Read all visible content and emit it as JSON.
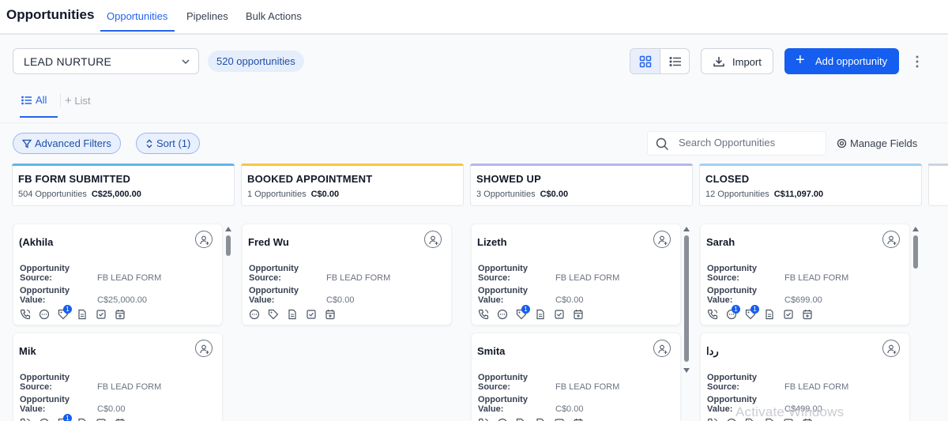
{
  "header": {
    "title": "Opportunities",
    "tabs": [
      {
        "label": "Opportunities",
        "active": true
      },
      {
        "label": "Pipelines",
        "active": false
      },
      {
        "label": "Bulk Actions",
        "active": false
      }
    ]
  },
  "toolbar": {
    "pipeline": "LEAD NURTURE",
    "count": "520 opportunities",
    "view_mode": "board",
    "import_label": "Import",
    "add_label": "Add opportunity"
  },
  "subtabs": {
    "all_label": "All",
    "list_label": "List"
  },
  "filters": {
    "advanced_label": "Advanced Filters",
    "sort_label": "Sort (1)",
    "search_placeholder": "Search Opportunities",
    "manage_fields_label": "Manage Fields"
  },
  "labels": {
    "source_key": "Opportunity Source:",
    "value_key": "Opportunity Value:"
  },
  "colors": {
    "accent": "#155eef",
    "fb_form_submitted": "#5fb6e8",
    "booked_appointment": "#f5c842",
    "showed_up": "#b7b4ef",
    "closed": "#9fd2ef"
  },
  "stages": [
    {
      "name": "FB FORM SUBMITTED",
      "count": "504 Opportunities",
      "value": "C$25,000.00",
      "cards": [
        {
          "name": "(Akhila",
          "source": "FB LEAD FORM",
          "value": "C$25,000.00",
          "icons": [
            "phone-icon",
            "chat-icon",
            "tag-icon",
            "document-icon",
            "task-icon",
            "calendar-icon"
          ],
          "badges": {
            "tag-icon": "1"
          }
        },
        {
          "name": "Mik",
          "source": "FB LEAD FORM",
          "value": "C$0.00",
          "icons": [
            "phone-icon",
            "chat-icon",
            "tag-icon",
            "document-icon",
            "task-icon",
            "calendar-icon"
          ],
          "badges": {
            "tag-icon": "1"
          }
        }
      ]
    },
    {
      "name": "BOOKED APPOINTMENT",
      "count": "1 Opportunities",
      "value": "C$0.00",
      "cards": [
        {
          "name": "Fred Wu",
          "source": "FB LEAD FORM",
          "value": "C$0.00",
          "icons": [
            "chat-icon",
            "tag-icon",
            "document-icon",
            "task-icon",
            "calendar-icon"
          ],
          "badges": {}
        }
      ]
    },
    {
      "name": "SHOWED UP",
      "count": "3 Opportunities",
      "value": "C$0.00",
      "cards": [
        {
          "name": "Lizeth",
          "source": "FB LEAD FORM",
          "value": "C$0.00",
          "icons": [
            "phone-icon",
            "chat-icon",
            "tag-icon",
            "document-icon",
            "task-icon",
            "calendar-icon"
          ],
          "badges": {
            "tag-icon": "1"
          }
        },
        {
          "name": "Smita",
          "source": "FB LEAD FORM",
          "value": "C$0.00",
          "icons": [
            "phone-icon",
            "chat-icon",
            "tag-icon",
            "document-icon",
            "task-icon",
            "calendar-icon"
          ],
          "badges": {}
        }
      ]
    },
    {
      "name": "CLOSED",
      "count": "12 Opportunities",
      "value": "C$11,097.00",
      "cards": [
        {
          "name": "Sarah",
          "source": "FB LEAD FORM",
          "value": "C$699.00",
          "icons": [
            "phone-icon",
            "chat-icon",
            "tag-icon",
            "document-icon",
            "task-icon",
            "calendar-icon"
          ],
          "badges": {
            "chat-icon": "1",
            "tag-icon": "1"
          }
        },
        {
          "name": "ردا",
          "source": "FB LEAD FORM",
          "value": "C$499.00",
          "icons": [
            "phone-icon",
            "chat-icon",
            "tag-icon",
            "document-icon",
            "task-icon",
            "calendar-icon"
          ],
          "badges": {}
        }
      ]
    }
  ],
  "watermark": "Activate Windows"
}
